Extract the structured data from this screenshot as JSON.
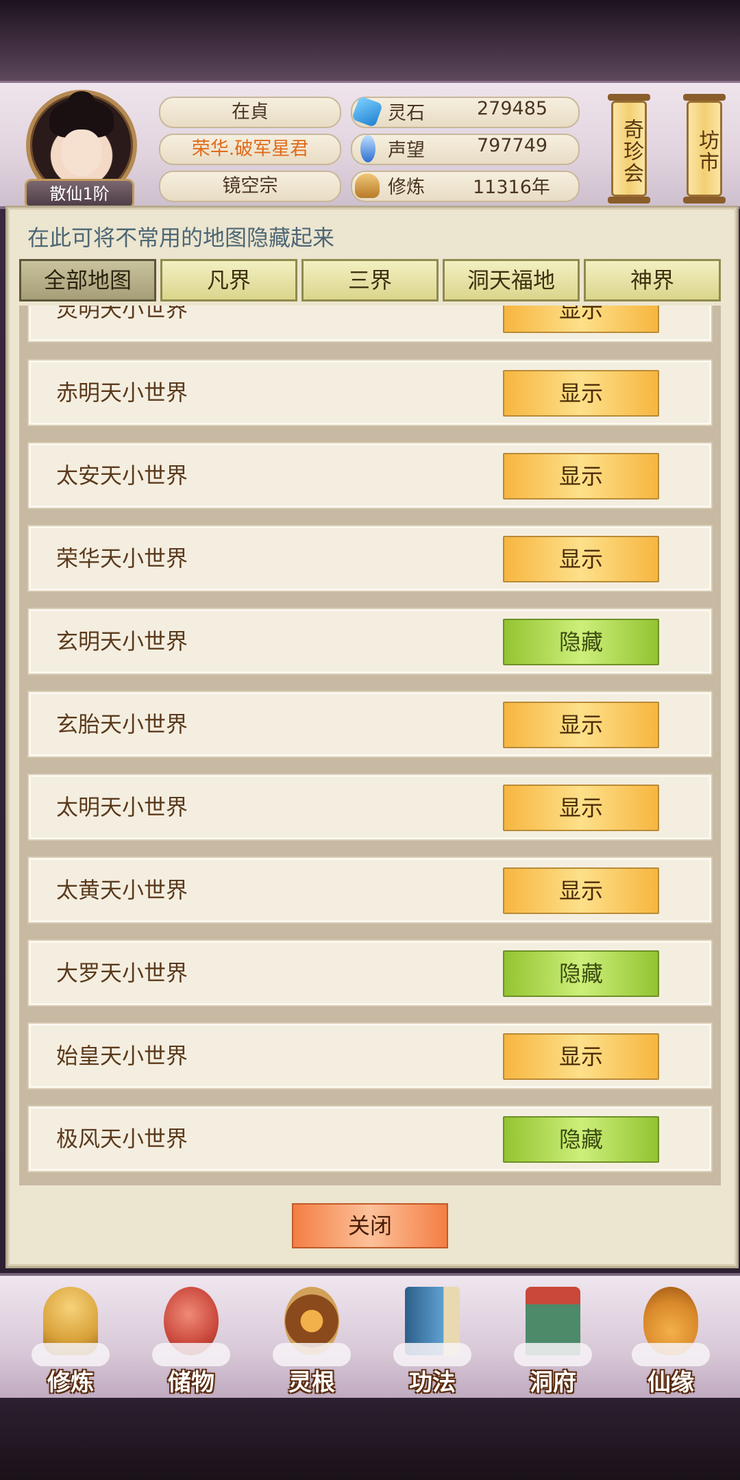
{
  "player": {
    "rank": "散仙1阶",
    "name": "在貞",
    "title": "荣华.破军星君",
    "sect": "镜空宗"
  },
  "stats": [
    {
      "label": "灵石",
      "value": "279485",
      "icon": "spirit-stone-icon",
      "color": "#3aa0e8"
    },
    {
      "label": "声望",
      "value": "797749",
      "icon": "reputation-icon",
      "color": "#2f6fd0"
    },
    {
      "label": "修炼",
      "value": "11316年",
      "icon": "cultivation-icon",
      "color": "#d8a040"
    }
  ],
  "side_buttons": {
    "treasure_fair": "奇珍会",
    "market": "坊市"
  },
  "notice": "在此可将不常用的地图隐藏起来",
  "tabs": [
    {
      "label": "全部地图",
      "active": true
    },
    {
      "label": "凡界",
      "active": false
    },
    {
      "label": "三界",
      "active": false
    },
    {
      "label": "洞天福地",
      "active": false
    },
    {
      "label": "神界",
      "active": false
    }
  ],
  "partial_row": {
    "name": "灵明天小世界",
    "button": "显示"
  },
  "rows": [
    {
      "name": "赤明天小世界",
      "button": "显示",
      "state": "show"
    },
    {
      "name": "太安天小世界",
      "button": "显示",
      "state": "show"
    },
    {
      "name": "荣华天小世界",
      "button": "显示",
      "state": "show"
    },
    {
      "name": "玄明天小世界",
      "button": "隐藏",
      "state": "hide"
    },
    {
      "name": "玄胎天小世界",
      "button": "显示",
      "state": "show"
    },
    {
      "name": "太明天小世界",
      "button": "显示",
      "state": "show"
    },
    {
      "name": "太黄天小世界",
      "button": "显示",
      "state": "show"
    },
    {
      "name": "大罗天小世界",
      "button": "隐藏",
      "state": "hide"
    },
    {
      "name": "始皇天小世界",
      "button": "显示",
      "state": "show"
    },
    {
      "name": "极风天小世界",
      "button": "隐藏",
      "state": "hide"
    }
  ],
  "close_label": "关闭",
  "nav": [
    {
      "label": "修炼",
      "icon": "meditation-icon",
      "color": "#d9a23a"
    },
    {
      "label": "储物",
      "icon": "storage-bag-icon",
      "color": "#c9473a"
    },
    {
      "label": "灵根",
      "icon": "spirit-root-icon",
      "color": "#8a4a1c"
    },
    {
      "label": "功法",
      "icon": "scripture-book-icon",
      "color": "#3f7fb0"
    },
    {
      "label": "洞府",
      "icon": "cave-dwelling-icon",
      "color": "#4c8a6a"
    },
    {
      "label": "仙缘",
      "icon": "gourd-icon",
      "color": "#d9892a"
    }
  ]
}
